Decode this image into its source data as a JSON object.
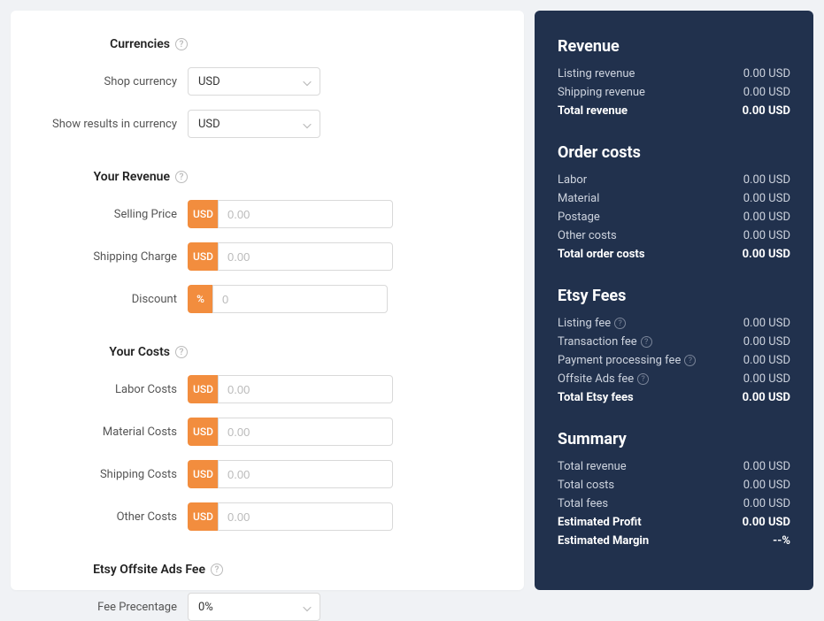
{
  "form": {
    "currencies": {
      "title": "Currencies",
      "shop_currency_label": "Shop currency",
      "shop_currency_value": "USD",
      "results_currency_label": "Show results in currency",
      "results_currency_value": "USD"
    },
    "revenue": {
      "title": "Your Revenue",
      "selling_price_label": "Selling Price",
      "selling_price_prefix": "USD",
      "selling_price_placeholder": "0.00",
      "shipping_charge_label": "Shipping Charge",
      "shipping_charge_prefix": "USD",
      "shipping_charge_placeholder": "0.00",
      "discount_label": "Discount",
      "discount_prefix": "%",
      "discount_placeholder": "0"
    },
    "costs": {
      "title": "Your Costs",
      "labor_label": "Labor Costs",
      "labor_prefix": "USD",
      "labor_placeholder": "0.00",
      "material_label": "Material Costs",
      "material_prefix": "USD",
      "material_placeholder": "0.00",
      "shipping_label": "Shipping Costs",
      "shipping_prefix": "USD",
      "shipping_placeholder": "0.00",
      "other_label": "Other Costs",
      "other_prefix": "USD",
      "other_placeholder": "0.00"
    },
    "offsite": {
      "title": "Etsy Offsite Ads Fee",
      "fee_label": "Fee Precentage",
      "fee_value": "0%"
    }
  },
  "results": {
    "revenue": {
      "title": "Revenue",
      "listing_label": "Listing revenue",
      "listing_value": "0.00 USD",
      "shipping_label": "Shipping revenue",
      "shipping_value": "0.00 USD",
      "total_label": "Total revenue",
      "total_value": "0.00 USD"
    },
    "order_costs": {
      "title": "Order costs",
      "labor_label": "Labor",
      "labor_value": "0.00 USD",
      "material_label": "Material",
      "material_value": "0.00 USD",
      "postage_label": "Postage",
      "postage_value": "0.00 USD",
      "other_label": "Other costs",
      "other_value": "0.00 USD",
      "total_label": "Total order costs",
      "total_value": "0.00 USD"
    },
    "etsy_fees": {
      "title": "Etsy Fees",
      "listing_fee_label": "Listing fee",
      "listing_fee_value": "0.00 USD",
      "transaction_fee_label": "Transaction fee",
      "transaction_fee_value": "0.00 USD",
      "payment_fee_label": "Payment processing fee",
      "payment_fee_value": "0.00 USD",
      "offsite_fee_label": "Offsite Ads fee",
      "offsite_fee_value": "0.00 USD",
      "total_label": "Total Etsy fees",
      "total_value": "0.00 USD"
    },
    "summary": {
      "title": "Summary",
      "total_revenue_label": "Total revenue",
      "total_revenue_value": "0.00 USD",
      "total_costs_label": "Total costs",
      "total_costs_value": "0.00 USD",
      "total_fees_label": "Total fees",
      "total_fees_value": "0.00 USD",
      "profit_label": "Estimated Profit",
      "profit_value": "0.00 USD",
      "margin_label": "Estimated Margin",
      "margin_value": "--%"
    }
  }
}
